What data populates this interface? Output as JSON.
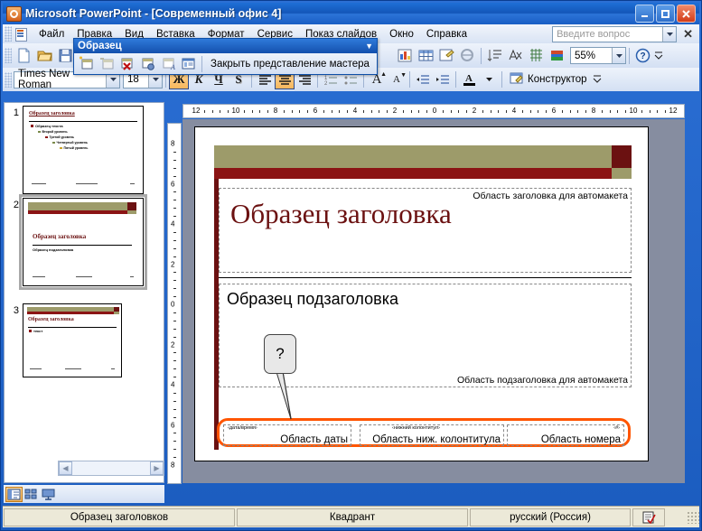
{
  "window": {
    "title": "Microsoft PowerPoint - [Современный офис 4]",
    "logo_icon": "powerpoint-logo-icon",
    "minimize_label": "_",
    "maximize_label": "□",
    "close_label": "✕"
  },
  "menu": {
    "items": [
      {
        "label": "Файл",
        "accel": "Ф"
      },
      {
        "label": "Правка",
        "accel": "П"
      },
      {
        "label": "Вид",
        "accel": "В"
      },
      {
        "label": "Вставка",
        "accel": "с"
      },
      {
        "label": "Формат",
        "accel": "м"
      },
      {
        "label": "Сервис",
        "accel": "С"
      },
      {
        "label": "Показ слайдов",
        "accel": "к"
      },
      {
        "label": "Окно",
        "accel": "О"
      },
      {
        "label": "Справка",
        "accel": "п"
      }
    ],
    "ask_placeholder": "Введите вопрос",
    "close_doc_label": "✕"
  },
  "toolbar": {
    "buttons": [
      {
        "name": "new-document-button",
        "icon": "new-document-icon"
      },
      {
        "name": "open-button",
        "icon": "open-folder-icon"
      },
      {
        "name": "save-button",
        "icon": "save-disk-icon"
      },
      {
        "name": "insert-chart-button",
        "icon": "chart-icon"
      },
      {
        "name": "insert-table-button",
        "icon": "table-icon"
      },
      {
        "name": "insert-object-button",
        "icon": "object-icon"
      },
      {
        "name": "insert-hyperlink-button",
        "icon": "hyperlink-icon"
      },
      {
        "name": "expand-all-button",
        "icon": "expand-all-icon"
      },
      {
        "name": "show-formatting-button",
        "icon": "show-formatting-icon"
      },
      {
        "name": "show-grid-button",
        "icon": "grid-icon"
      },
      {
        "name": "color-grayscale-button",
        "icon": "color-bars-icon"
      }
    ],
    "zoom_value": "55%",
    "help_icon": "help-question-icon",
    "overflow_icon": "toolbar-overflow-icon"
  },
  "format_bar": {
    "font_name": "Times New Roman",
    "font_size": "18",
    "bold_label": "Ж",
    "italic_label": "К",
    "underline_label": "Ч",
    "shadow_label": "S",
    "align_left_icon": "align-left-icon",
    "align_center_icon": "align-center-icon",
    "align_right_icon": "align-right-icon",
    "numbering_icon": "numbered-list-icon",
    "bullets_icon": "bulleted-list-icon",
    "grow_font_label": "A",
    "shrink_font_label": "A",
    "decrease_indent_icon": "decrease-indent-icon",
    "increase_indent_icon": "increase-indent-icon",
    "font_color_label": "A",
    "design_label": "Конструктор",
    "design_icon": "design-template-icon",
    "overflow_icon": "toolbar-overflow-icon"
  },
  "master_toolbar": {
    "title": "Образец",
    "dropdown_icon": "chevron-down-icon",
    "buttons": [
      {
        "name": "insert-new-slide-master-button",
        "icon": "new-slide-master-icon"
      },
      {
        "name": "insert-new-title-master-button",
        "icon": "new-title-master-icon"
      },
      {
        "name": "delete-master-button",
        "icon": "delete-master-icon"
      },
      {
        "name": "preserve-master-button",
        "icon": "preserve-master-icon"
      },
      {
        "name": "rename-master-button",
        "icon": "rename-master-icon"
      },
      {
        "name": "master-layout-button",
        "icon": "master-layout-icon"
      }
    ],
    "close_master_view_label": "Закрыть представление мастера"
  },
  "rulers": {
    "horizontal_ticks": [
      "12",
      "10",
      "8",
      "6",
      "4",
      "2",
      "0",
      "2",
      "4",
      "6",
      "8",
      "10",
      "12"
    ],
    "vertical_ticks": [
      "8",
      "6",
      "4",
      "2",
      "0",
      "2",
      "4",
      "6",
      "8"
    ]
  },
  "slide_pane": {
    "slides": [
      {
        "number": "1",
        "selected": false,
        "title": "Образец заголовка",
        "body_lines": [
          "Образец текста",
          "Второй уровень",
          "Третий уровень",
          "Четвертый уровень",
          "Пятый уровень"
        ]
      },
      {
        "number": "2",
        "selected": true,
        "title": "Образец заголовка",
        "body_lines": [
          "Образец подзаголовка"
        ]
      },
      {
        "number": "3",
        "selected": false,
        "title": "Образец заголовка",
        "body_lines": [
          "текст"
        ]
      }
    ]
  },
  "slide": {
    "title_placeholder_label": "Область заголовка для автомакета",
    "title_text": "Образец заголовка",
    "subtitle_placeholder_label": "Область подзаголовка для автомакета",
    "subtitle_text": "Образец подзаголовка",
    "callout_text": "?",
    "footer_placeholders": [
      {
        "tag": "‹дата/время›",
        "label": "Область даты",
        "name": "date-placeholder"
      },
      {
        "tag": "‹нижний колонтитул›",
        "label": "Область ниж. колонтитула",
        "name": "footer-placeholder"
      },
      {
        "tag": "‹#›",
        "label": "Область номера",
        "name": "slide-number-placeholder"
      }
    ],
    "colors": {
      "band_olive": "#9d9b6a",
      "band_red": "#8b1414",
      "title_color": "#6b1111",
      "highlight": "#ff5500"
    }
  },
  "view_bar": {
    "normal_view_icon": "normal-view-icon",
    "slide_sorter_icon": "slide-sorter-icon",
    "slide_show_icon": "slide-show-icon",
    "scroll_left_icon": "chevron-left-icon",
    "scroll_right_icon": "chevron-right-icon"
  },
  "status_bar": {
    "view_name": "Образец заголовков",
    "design_name": "Квадрант",
    "language": "русский (Россия)",
    "spellcheck_icon": "spellcheck-icon"
  }
}
